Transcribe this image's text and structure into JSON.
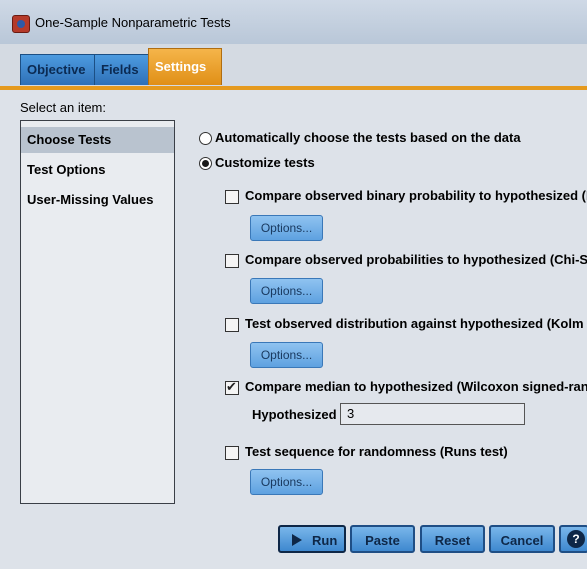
{
  "window": {
    "title": "One-Sample Nonparametric Tests"
  },
  "tabs": [
    {
      "label": "Objective"
    },
    {
      "label": "Fields"
    },
    {
      "label": "Settings"
    }
  ],
  "sidebar": {
    "heading": "Select an item:",
    "items": [
      {
        "label": "Choose Tests",
        "selected": true
      },
      {
        "label": "Test Options",
        "selected": false
      },
      {
        "label": "User-Missing Values",
        "selected": false
      }
    ]
  },
  "main": {
    "radio_auto": {
      "label": "Automatically choose the tests based on the data",
      "checked": false
    },
    "radio_custom": {
      "label": "Customize tests",
      "checked": true
    },
    "tests": [
      {
        "label": "Compare observed binary probability to hypothesized (B",
        "checked": false,
        "options_label": "Options..."
      },
      {
        "label": "Compare observed probabilities to hypothesized (Chi-S",
        "checked": false,
        "options_label": "Options..."
      },
      {
        "label": "Test observed distribution against hypothesized (Kolm",
        "checked": false,
        "options_label": "Options..."
      },
      {
        "label": "Compare median to hypothesized (Wilcoxon signed-ran",
        "checked": true
      },
      {
        "label": "Test sequence for randomness (Runs test)",
        "checked": false,
        "options_label": "Options..."
      }
    ],
    "median": {
      "label": "Hypothesized median:",
      "value": "3"
    }
  },
  "buttons": {
    "run": "Run",
    "paste": "Paste",
    "reset": "Reset",
    "cancel": "Cancel",
    "help": "?"
  },
  "colors": {
    "accent": "#e59a1e",
    "button": "#3e88cf"
  }
}
